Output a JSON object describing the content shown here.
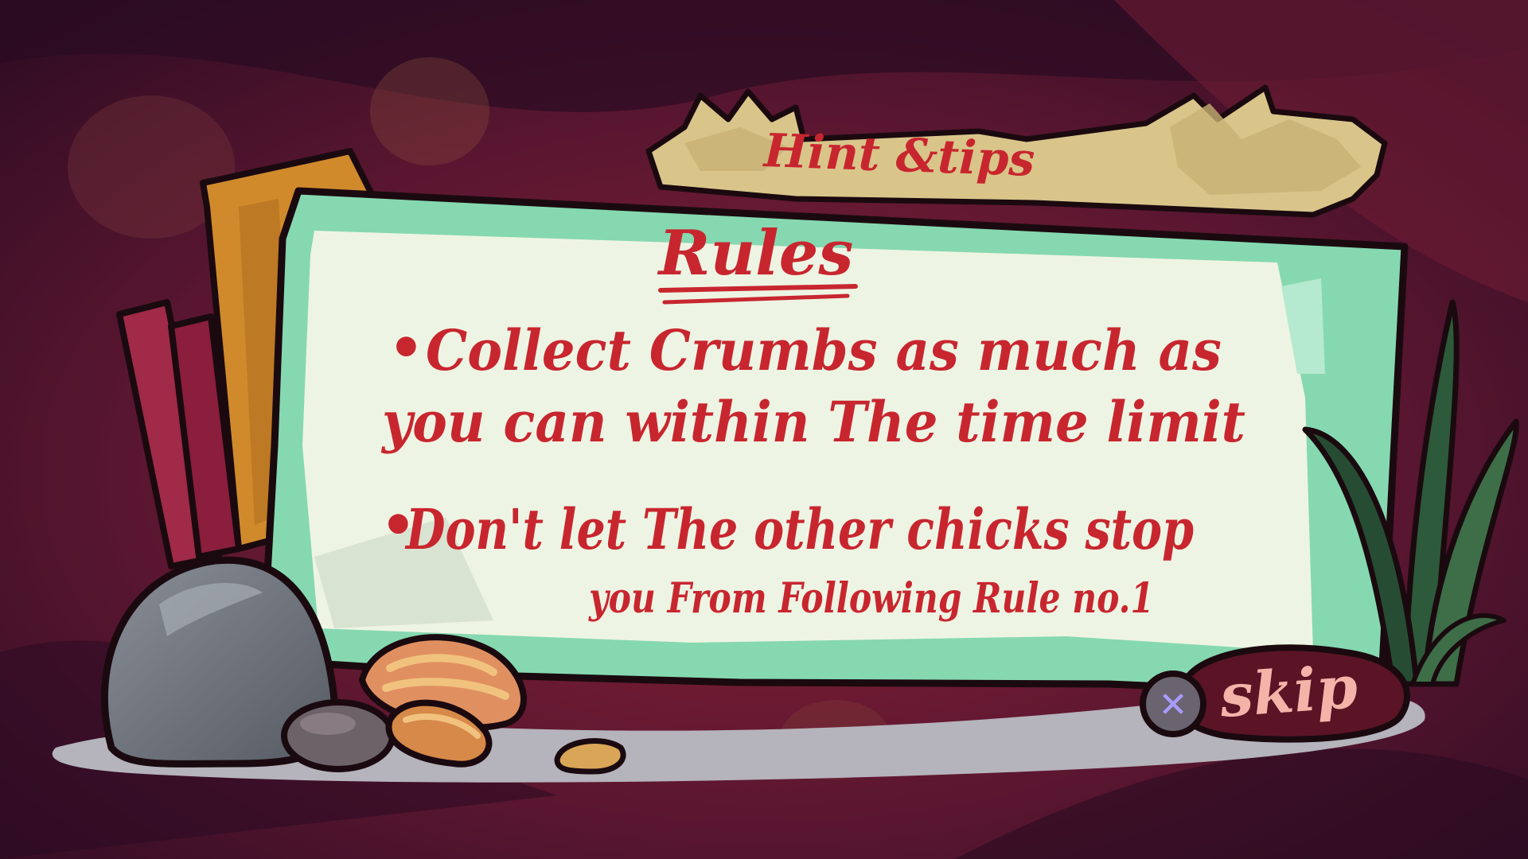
{
  "banner": {
    "label": "Hint &tips"
  },
  "board": {
    "title": "Rules",
    "rules": [
      {
        "bullet": "•",
        "line1": "Collect Crumbs as much as",
        "line2": "you can within The time limit"
      },
      {
        "bullet": "•",
        "line1": "Don't let The other chicks stop",
        "line2": "you From Following Rule no.1"
      }
    ]
  },
  "skip": {
    "button_glyph": "✕",
    "label": "skip"
  },
  "colors": {
    "background": "#3a1024",
    "board_frame": "#86d8b1",
    "board_paper": "#eef4e3",
    "handwriting": "#c8262f",
    "banner": "#d9c58a",
    "skip_stone": "#5a1426",
    "skip_text": "#f4b3a8"
  },
  "icons": {
    "skip_button": "x-button-icon",
    "decorations": [
      "rock-icon",
      "seed-icon",
      "stick-icon",
      "grass-icon"
    ]
  }
}
